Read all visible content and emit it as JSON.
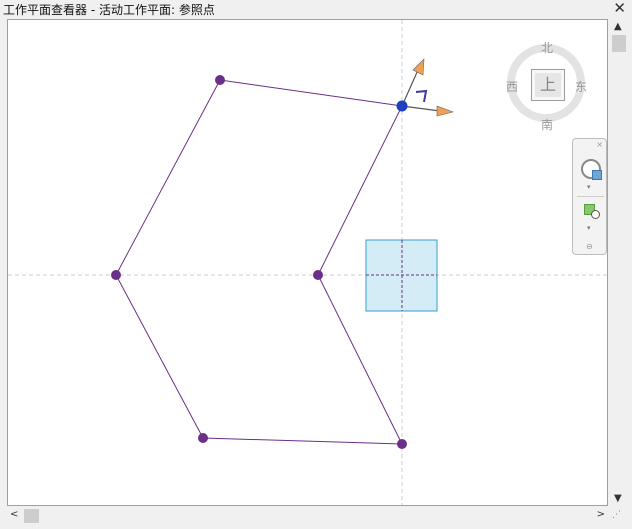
{
  "window": {
    "title": "工作平面查看器 - 活动工作平面: 参照点",
    "close_glyph": "✕"
  },
  "viewcube": {
    "face_label": "上",
    "north": "北",
    "south": "南",
    "east": "东",
    "west": "西"
  },
  "navbar": {
    "close_glyph": "×",
    "dropdown_glyph": "▾",
    "end_glyph": "⊖"
  },
  "scrollbars": {
    "up_glyph": "▲",
    "down_glyph": "▼",
    "left_glyph": "<",
    "right_glyph": ">",
    "grip_glyph": "⋰"
  },
  "colors": {
    "shape_line": "#6b2f87",
    "shape_point": "#6b2f87",
    "active_point": "#1f3fbf",
    "plane_fill": "#d4ecf6",
    "plane_border": "#3a9cc4",
    "axis_arrow": "#f0a050",
    "crosshair": "#cccccc"
  }
}
